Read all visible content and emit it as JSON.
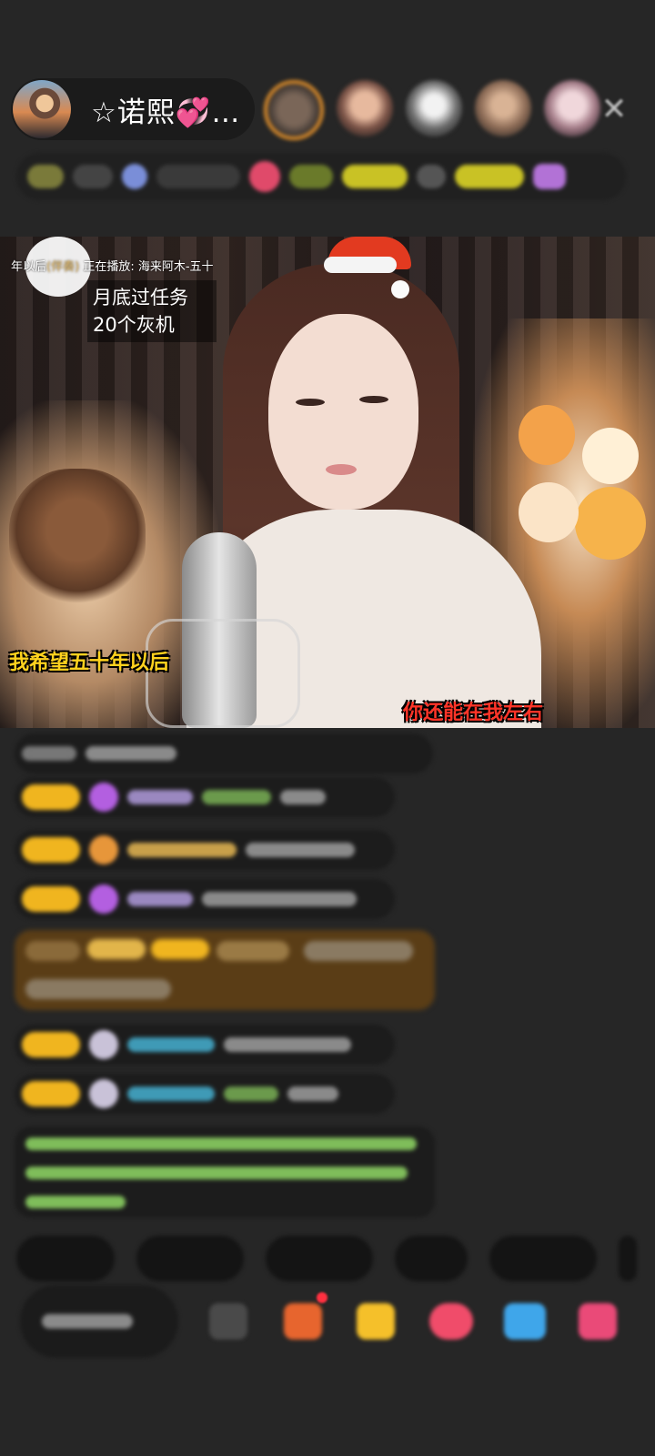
{
  "host": {
    "name": "☆诺熙",
    "name_emoji": "💞",
    "ellipsis": "…"
  },
  "video": {
    "now_playing_prefix": "年以后",
    "now_playing_tag": "(伴奏)",
    "now_playing_label": "正在播放:",
    "now_playing_song": "海来阿木-五十",
    "task_line1": "月底过任务",
    "task_line2": "20个灰机",
    "lyric_left": "我希望五十年以后",
    "lyric_right": "你还能在我左右"
  },
  "controls": {
    "close": "✕"
  },
  "colors": {
    "background": "#262626",
    "level_badge": "#f0b51f",
    "lyric_left": "#ffd21e",
    "lyric_right": "#ff3428",
    "task_text": "#ffffff"
  },
  "icons": {
    "close": "close-icon",
    "gift": "gift-icon",
    "emoji": "emoji-icon"
  }
}
